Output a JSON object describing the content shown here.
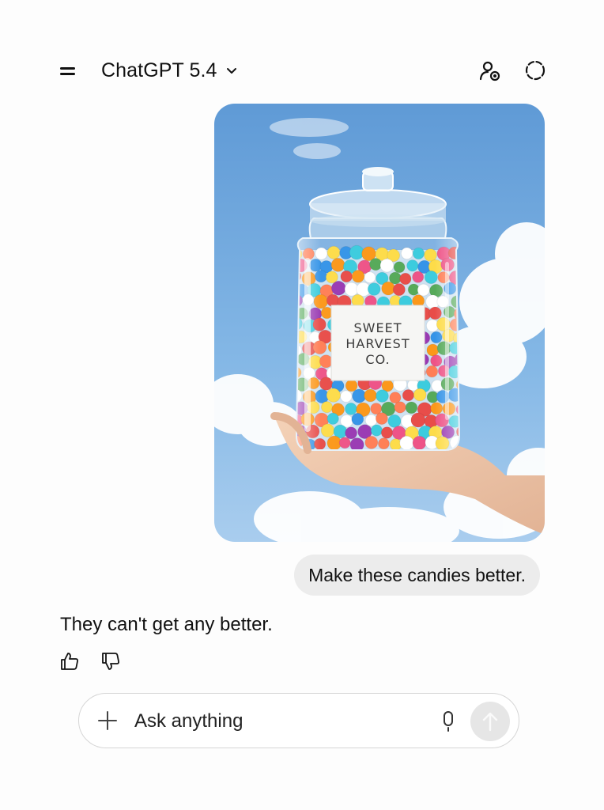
{
  "header": {
    "model_name": "ChatGPT 5.4",
    "menu_icon": "hamburger-menu-icon",
    "model_chevron_icon": "chevron-down-icon",
    "share_icon": "add-person-icon",
    "temporary_chat_icon": "dashed-circle-icon"
  },
  "conversation": {
    "user_image": {
      "jar_label_lines": [
        "SWEET",
        "HARVEST",
        "CO."
      ]
    },
    "user_message": "Make these candies better.",
    "assistant_message": "They can't get any better.",
    "feedback_icons": [
      "thumbs-up-icon",
      "thumbs-down-icon"
    ]
  },
  "composer": {
    "placeholder": "Ask anything",
    "plus_icon": "plus-icon",
    "mic_icon": "microphone-icon",
    "send_icon": "arrow-up-icon"
  },
  "colors": {
    "page_bg": "#fdfdfd",
    "bubble_bg": "#ececec",
    "send_bg": "#e6e6e6",
    "sky": "#6fa6dc"
  }
}
